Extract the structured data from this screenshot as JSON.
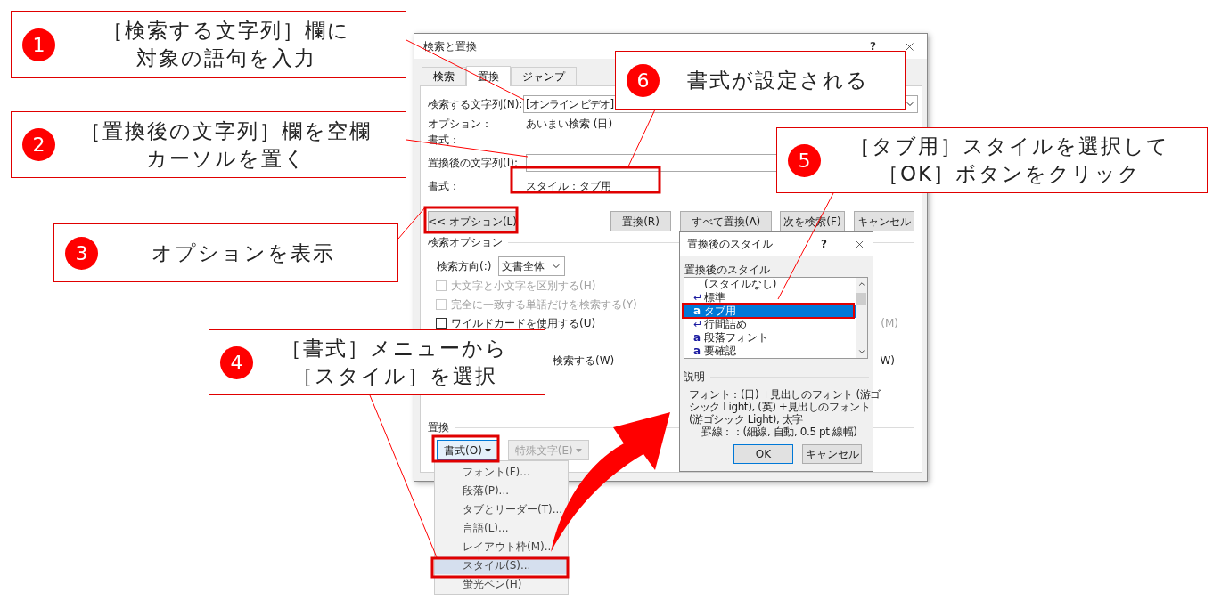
{
  "dialog": {
    "title": "検索と置換",
    "help": "?",
    "tabs": [
      {
        "label": "検索",
        "selected": false
      },
      {
        "label": "置換",
        "selected": true
      },
      {
        "label": "ジャンプ",
        "selected": false
      }
    ],
    "find": {
      "label": "検索する文字列(N):",
      "value": "[オンライン ビデオ]"
    },
    "find_options": {
      "label": "オプション：",
      "value": "あいまい検索 (日)"
    },
    "find_format": {
      "label": "書式："
    },
    "replace": {
      "label": "置換後の文字列(I):"
    },
    "replace_format": {
      "label": "書式：",
      "value": "スタイル：タブ用"
    },
    "buttons": [
      {
        "label": "<< オプション(L)"
      },
      {
        "label": "置換(R)"
      },
      {
        "label": "すべて置換(A)"
      },
      {
        "label": "次を検索(F)"
      },
      {
        "label": "キャンセル"
      }
    ],
    "search_options": {
      "title": "検索オプション",
      "direction_label": "検索方向(:)",
      "direction_value": "文書全体",
      "checkboxes": [
        {
          "label": "大文字と小文字を区別する(H)",
          "checked": false,
          "disabled": true
        },
        {
          "label": "完全に一致する単語だけを検索する(Y)",
          "checked": false,
          "disabled": true
        },
        {
          "label": "ワイルドカードを使用する(U)",
          "checked": false,
          "disabled": false
        }
      ],
      "partial_left": "検索する(W)",
      "partial_right": [
        "(M)",
        "W)"
      ]
    },
    "replace_section": {
      "title": "置換",
      "buttons": [
        {
          "label": "書式(O)",
          "disabled": false
        },
        {
          "label": "特殊文字(E)",
          "disabled": true
        }
      ]
    }
  },
  "format_menu": {
    "items": [
      {
        "label": "フォント(F)...",
        "selected": false
      },
      {
        "label": "段落(P)...",
        "selected": false
      },
      {
        "label": "タブとリーダー(T)...",
        "selected": false
      },
      {
        "label": "言語(L)...",
        "selected": false
      },
      {
        "label": "レイアウト枠(M)...",
        "selected": false
      },
      {
        "label": "スタイル(S)...",
        "selected": true
      },
      {
        "label": "蛍光ペン(H)",
        "selected": false
      }
    ]
  },
  "style_dialog": {
    "title": "置換後のスタイル",
    "help": "?",
    "list_label": "置換後のスタイル",
    "styles": [
      {
        "label": "(スタイルなし)",
        "kind": "none",
        "selected": false
      },
      {
        "label": "標準",
        "kind": "paragraph",
        "icon": "↵",
        "selected": false
      },
      {
        "label": "タブ用",
        "kind": "character",
        "icon": "a",
        "selected": true
      },
      {
        "label": "行間詰め",
        "kind": "paragraph",
        "icon": "↵",
        "selected": false
      },
      {
        "label": "段落フォント",
        "kind": "character",
        "icon": "a",
        "selected": false
      },
      {
        "label": "要確認",
        "kind": "character",
        "icon": "a",
        "selected": false
      }
    ],
    "description_title": "説明",
    "description_lines": [
      "フォント：(日) +見出しのフォント (游ゴ",
      "シック Light), (英) +見出しのフォント",
      "(游ゴシック Light), 太字",
      "罫線：：(細線, 自動,  0.5 pt 線幅)"
    ],
    "buttons": [
      {
        "label": "OK"
      },
      {
        "label": "キャンセル"
      }
    ]
  },
  "callouts": [
    {
      "number": "1",
      "lines": [
        "［検索する文字列］欄に",
        "対象の語句を入力"
      ]
    },
    {
      "number": "2",
      "lines": [
        "［置換後の文字列］欄を空欄",
        "カーソルを置く"
      ]
    },
    {
      "number": "3",
      "lines": [
        "オプションを表示"
      ]
    },
    {
      "number": "4",
      "lines": [
        "［書式］メニューから",
        "［スタイル］を選択"
      ]
    },
    {
      "number": "5",
      "lines": [
        "［タブ用］スタイルを選択して",
        "［OK］ボタンをクリック"
      ]
    },
    {
      "number": "6",
      "lines": [
        "書式が設定される"
      ]
    }
  ]
}
